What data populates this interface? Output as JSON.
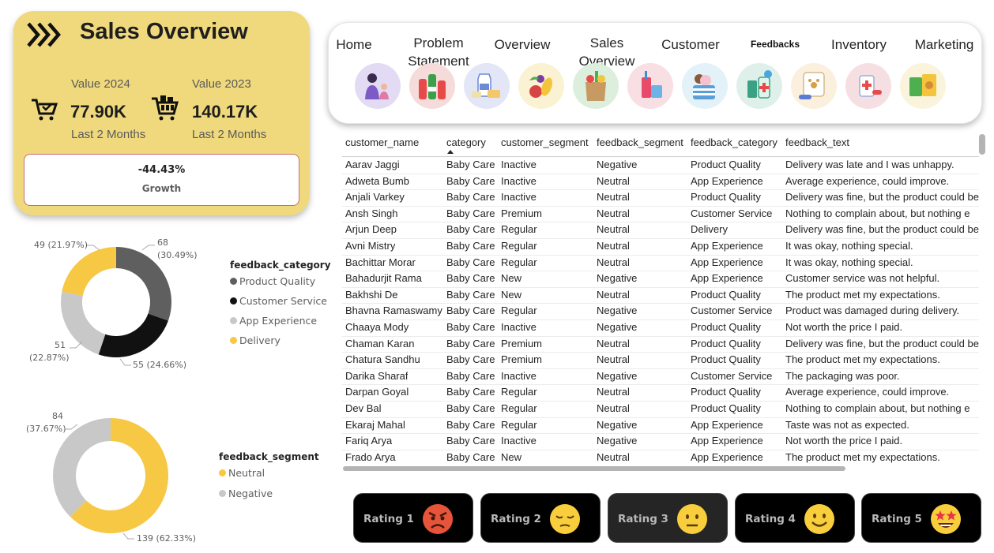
{
  "card": {
    "title": "Sales Overview",
    "label_2024": "Value 2024",
    "value_2024": "77.90K",
    "sub_2024": "Last 2 Months",
    "label_2023": "Value 2023",
    "value_2023": "140.17K",
    "sub_2023": "Last 2 Months",
    "growth_value": "-44.43%",
    "growth_label": "Growth"
  },
  "nav": {
    "tabs": [
      {
        "label": "Home"
      },
      {
        "label": "Problem Statement"
      },
      {
        "label": "Overview"
      },
      {
        "label": "Sales Overview"
      },
      {
        "label": "Customer"
      },
      {
        "label": "Feedbacks",
        "active": true
      },
      {
        "label": "Inventory"
      },
      {
        "label": "Marketing"
      }
    ],
    "icons": [
      "mother-baby-icon",
      "beverages-icon",
      "dairy-icon",
      "fruits-vegetables-icon",
      "grocery-bag-icon",
      "drinks-snacks-icon",
      "ice-cream-icon",
      "pharmacy-icon",
      "pet-care-icon",
      "medicine-icon",
      "snacks-icon"
    ]
  },
  "table": {
    "columns": [
      "customer_name",
      "category",
      "customer_segment",
      "feedback_segment",
      "feedback_category",
      "feedback_text"
    ],
    "sorted_column": "category",
    "rows": [
      [
        "Aarav Jaggi",
        "Baby Care",
        "Inactive",
        "Negative",
        "Product Quality",
        "Delivery was late and I was unhappy."
      ],
      [
        "Adweta Bumb",
        "Baby Care",
        "Inactive",
        "Neutral",
        "App Experience",
        "Average experience, could improve."
      ],
      [
        "Anjali Varkey",
        "Baby Care",
        "Inactive",
        "Neutral",
        "Product Quality",
        "Delivery was fine, but the product could be"
      ],
      [
        "Ansh Singh",
        "Baby Care",
        "Premium",
        "Neutral",
        "Customer Service",
        "Nothing to complain about, but nothing e"
      ],
      [
        "Arjun Deep",
        "Baby Care",
        "Regular",
        "Neutral",
        "Delivery",
        "Delivery was fine, but the product could be"
      ],
      [
        "Avni Mistry",
        "Baby Care",
        "Regular",
        "Neutral",
        "App Experience",
        "It was okay, nothing special."
      ],
      [
        "Bachittar Morar",
        "Baby Care",
        "Regular",
        "Neutral",
        "App Experience",
        "It was okay, nothing special."
      ],
      [
        "Bahadurjit Rama",
        "Baby Care",
        "New",
        "Negative",
        "App Experience",
        "Customer service was not helpful."
      ],
      [
        "Bakhshi De",
        "Baby Care",
        "New",
        "Neutral",
        "Product Quality",
        "The product met my expectations."
      ],
      [
        "Bhavna Ramaswamy",
        "Baby Care",
        "Regular",
        "Negative",
        "Customer Service",
        "Product was damaged during delivery."
      ],
      [
        "Chaaya Mody",
        "Baby Care",
        "Inactive",
        "Negative",
        "Product Quality",
        "Not worth the price I paid."
      ],
      [
        "Chaman Karan",
        "Baby Care",
        "Premium",
        "Neutral",
        "Product Quality",
        "Delivery was fine, but the product could be"
      ],
      [
        "Chatura Sandhu",
        "Baby Care",
        "Premium",
        "Neutral",
        "Product Quality",
        "The product met my expectations."
      ],
      [
        "Darika Sharaf",
        "Baby Care",
        "Inactive",
        "Negative",
        "Customer Service",
        "The packaging was poor."
      ],
      [
        "Darpan Goyal",
        "Baby Care",
        "Regular",
        "Neutral",
        "Product Quality",
        "Average experience, could improve."
      ],
      [
        "Dev Bal",
        "Baby Care",
        "Regular",
        "Neutral",
        "Product Quality",
        "Nothing to complain about, but nothing e"
      ],
      [
        "Ekaraj Mahal",
        "Baby Care",
        "Regular",
        "Negative",
        "App Experience",
        "Taste was not as expected."
      ],
      [
        "Fariq Arya",
        "Baby Care",
        "Inactive",
        "Negative",
        "App Experience",
        "Not worth the price I paid."
      ],
      [
        "Frado Arya",
        "Baby Care",
        "New",
        "Neutral",
        "App Experience",
        "The product met my expectations."
      ]
    ]
  },
  "chart_data": [
    {
      "type": "pie",
      "legend_title": "feedback_category",
      "legend_position": "right",
      "categories": [
        "Product Quality",
        "Customer Service",
        "App Experience",
        "Delivery"
      ],
      "values": [
        68,
        55,
        51,
        49
      ],
      "percent_labels": [
        "(30.49%)",
        "(24.66%)",
        "(22.87%)",
        "(21.97%)"
      ],
      "colors": [
        "#5f5f5f",
        "#111111",
        "#c8c8c8",
        "#f7c843"
      ]
    },
    {
      "type": "pie",
      "legend_title": "feedback_segment",
      "legend_position": "right",
      "categories": [
        "Neutral",
        "Negative"
      ],
      "values": [
        139,
        84
      ],
      "percent_labels": [
        "(62.33%)",
        "(37.67%)"
      ],
      "colors": [
        "#f7c843",
        "#c8c8c8"
      ]
    }
  ],
  "ratings": [
    {
      "label": "Rating 1",
      "icon": "angry-face-icon"
    },
    {
      "label": "Rating 2",
      "icon": "pensive-face-icon"
    },
    {
      "label": "Rating 3",
      "icon": "neutral-face-icon",
      "selected": true
    },
    {
      "label": "Rating 4",
      "icon": "smiling-face-icon"
    },
    {
      "label": "Rating 5",
      "icon": "star-struck-face-icon"
    }
  ]
}
